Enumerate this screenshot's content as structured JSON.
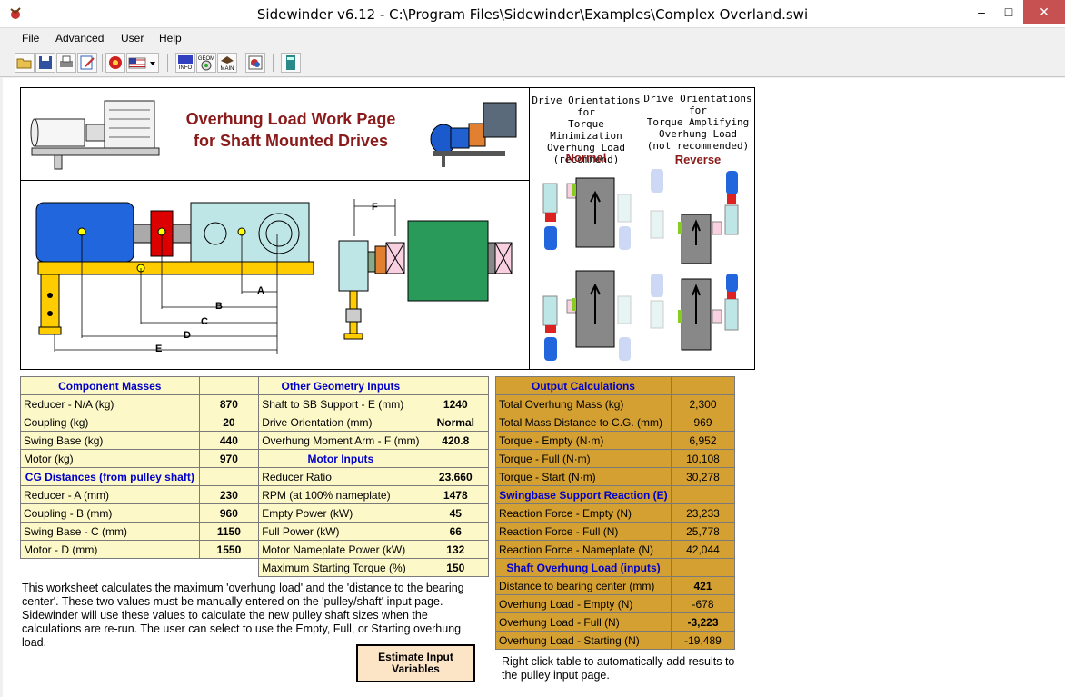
{
  "window": {
    "title": "Sidewinder v6.12 - C:\\Program Files\\Sidewinder\\Examples\\Complex Overland.swi",
    "minimize": "–",
    "maximize": "□",
    "close": "✕"
  },
  "menu": [
    "File",
    "Advanced",
    "User",
    "Help"
  ],
  "toolbar": {
    "icons": [
      "open-icon",
      "save-icon",
      "print-icon",
      "edit-icon",
      "units-icon",
      "flag-icon",
      "info-icon",
      "geometry-icon",
      "main-icon",
      "chart-icon",
      "calculator-icon"
    ],
    "info_text": "INFO",
    "geom_text": "GEOM",
    "main_text": "MAIN"
  },
  "header": {
    "line1": "Overhung Load Work Page",
    "line2": "for Shaft Mounted Drives"
  },
  "orientation": {
    "left_note": [
      "Drive Orientations for",
      "Torque Minimization",
      "Overhung Load",
      "(recommend)"
    ],
    "left_label": "Normal",
    "right_note": [
      "Drive Orientations for",
      "Torque Amplifying",
      "Overhung Load",
      "(not recommended)"
    ],
    "right_label": "Reverse"
  },
  "diagram_labels": {
    "A": "A",
    "B": "B",
    "C": "C",
    "D": "D",
    "E": "E",
    "F": "F"
  },
  "left_table": {
    "rows": [
      {
        "l": "Component Masses",
        "lv": "",
        "r": "Other Geometry Inputs",
        "rv": "",
        "lsec": true,
        "rsec": true
      },
      {
        "l": "Reducer - N/A (kg)",
        "lv": "870",
        "r": "Shaft to SB Support - E (mm)",
        "rv": "1240"
      },
      {
        "l": "Coupling (kg)",
        "lv": "20",
        "r": "Drive Orientation (mm)",
        "rv": "Normal"
      },
      {
        "l": "Swing Base (kg)",
        "lv": "440",
        "r": "Overhung Moment Arm - F (mm)",
        "rv": "420.8"
      },
      {
        "l": "Motor (kg)",
        "lv": "970",
        "r": "Motor Inputs",
        "rv": "",
        "rsec": true
      },
      {
        "l": "CG Distances (from pulley shaft)",
        "lv": "",
        "r": "Reducer Ratio",
        "rv": "23.660",
        "lsec": true
      },
      {
        "l": "Reducer - A (mm)",
        "lv": "230",
        "r": "RPM (at 100% nameplate)",
        "rv": "1478"
      },
      {
        "l": "Coupling - B (mm)",
        "lv": "960",
        "r": "Empty Power (kW)",
        "rv": "45"
      },
      {
        "l": "Swing Base - C (mm)",
        "lv": "1150",
        "r": "Full Power (kW)",
        "rv": "66"
      },
      {
        "l": "Motor - D (mm)",
        "lv": "1550",
        "r": "Motor Nameplate Power (kW)",
        "rv": "132"
      },
      {
        "l": "",
        "lv": "",
        "r": "Maximum Starting Torque (%)",
        "rv": "150",
        "noleft": true
      }
    ]
  },
  "output_table": {
    "rows": [
      {
        "l": "Output Calculations",
        "v": "",
        "sec": true
      },
      {
        "l": "Total Overhung Mass (kg)",
        "v": "2,300"
      },
      {
        "l": "Total Mass Distance to C.G. (mm)",
        "v": "969"
      },
      {
        "l": "Torque - Empty (N·m)",
        "v": "6,952"
      },
      {
        "l": "Torque - Full (N·m)",
        "v": "10,108"
      },
      {
        "l": "Torque - Start (N·m)",
        "v": "30,278"
      },
      {
        "l": "Swingbase Support Reaction (E)",
        "v": "",
        "sec": true
      },
      {
        "l": "Reaction Force - Empty (N)",
        "v": "23,233"
      },
      {
        "l": "Reaction Force - Full (N)",
        "v": "25,778"
      },
      {
        "l": "Reaction Force - Nameplate (N)",
        "v": "42,044"
      },
      {
        "l": "Shaft Overhung Load (inputs)",
        "v": "",
        "sec": true
      },
      {
        "l": "Distance to bearing center (mm)",
        "v": "421",
        "bold": true
      },
      {
        "l": "Overhung Load - Empty (N)",
        "v": "-678"
      },
      {
        "l": "Overhung Load - Full (N)",
        "v": "-3,223",
        "bold": true
      },
      {
        "l": "Overhung Load - Starting (N)",
        "v": "-19,489"
      }
    ]
  },
  "description": "This worksheet calculates the maximum 'overhung load' and the 'distance to the bearing center'. These two values must be manually entered on the 'pulley/shaft' input page. Sidewinder will use these values to calculate the new pulley shaft sizes when the calculations are re-run. The user can select to use the Empty, Full, or Starting overhung load.",
  "estimate_button": [
    "Estimate Input",
    "Variables"
  ],
  "right_click_note": "Right click table to automatically add results to the pulley input page.",
  "colors": {
    "heading": "#8b1a1a",
    "section": "#0000c8",
    "input_bg": "#fdf8c8",
    "output_bg": "#d4a032"
  }
}
